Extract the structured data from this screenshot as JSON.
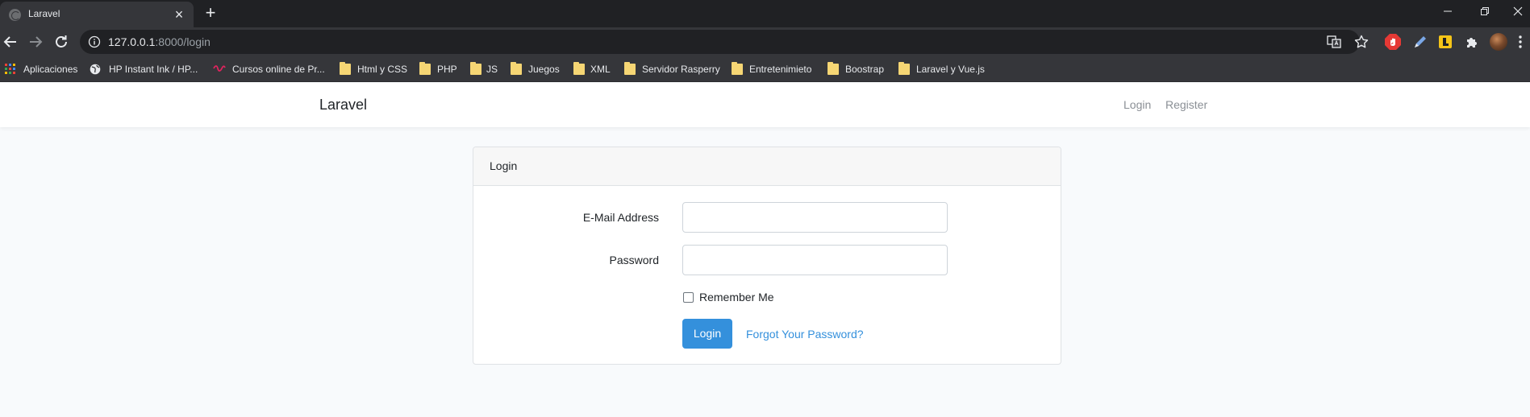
{
  "browser": {
    "tab": {
      "title": "Laravel"
    },
    "address": {
      "host": "127.0.0.1",
      "path": ":8000/login"
    },
    "bookmarks": [
      {
        "label": "Aplicaciones",
        "icon": "apps-grid-icon"
      },
      {
        "label": "HP Instant Ink / HP...",
        "icon": "globe-icon"
      },
      {
        "label": "Cursos online de Pr...",
        "icon": "wave-icon"
      },
      {
        "label": "Html y CSS",
        "icon": "folder-icon"
      },
      {
        "label": "PHP",
        "icon": "folder-icon"
      },
      {
        "label": "JS",
        "icon": "folder-icon"
      },
      {
        "label": "Juegos",
        "icon": "folder-icon"
      },
      {
        "label": "XML",
        "icon": "folder-icon"
      },
      {
        "label": "Servidor Rasperry",
        "icon": "folder-icon"
      },
      {
        "label": "Entretenimieto",
        "icon": "folder-icon"
      },
      {
        "label": "Boostrap",
        "icon": "folder-icon"
      },
      {
        "label": "Laravel y Vue.js",
        "icon": "folder-icon"
      }
    ]
  },
  "navbar": {
    "brand": "Laravel",
    "links": {
      "login": "Login",
      "register": "Register"
    }
  },
  "login_card": {
    "header": "Login",
    "email_label": "E-Mail Address",
    "email_value": "",
    "password_label": "Password",
    "password_value": "",
    "remember_label": "Remember Me",
    "remember_checked": false,
    "submit_label": "Login",
    "forgot_label": "Forgot Your Password?"
  },
  "colors": {
    "primary": "#3490dc",
    "page_bg": "#f8fafc",
    "chrome_dark": "#202124",
    "chrome_toolbar": "#35363a"
  }
}
